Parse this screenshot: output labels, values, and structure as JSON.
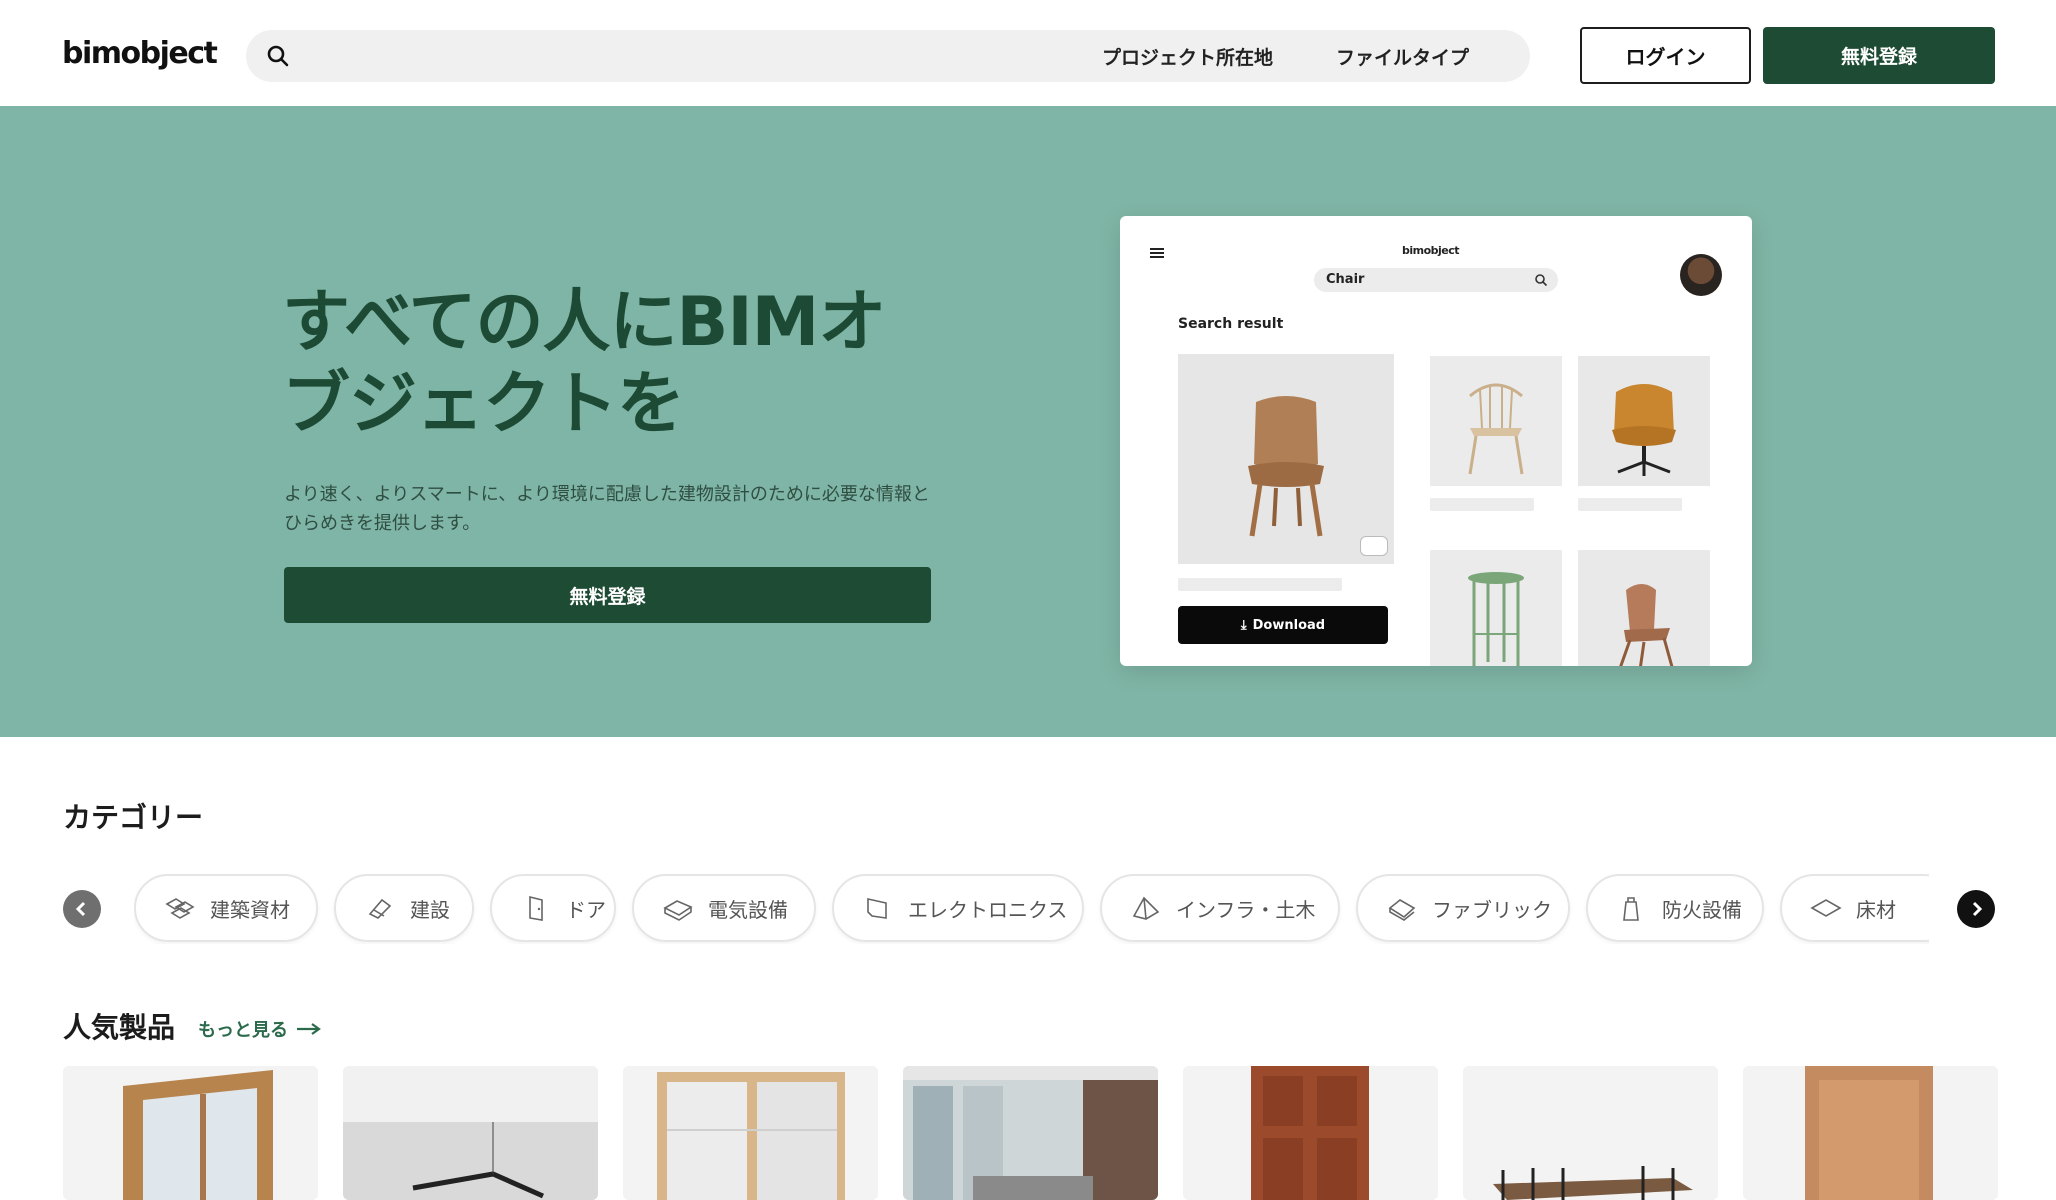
{
  "header": {
    "logo": "bimobject",
    "search_options": [
      "プロジェクト所在地",
      "ファイルタイプ"
    ],
    "login_label": "ログイン",
    "register_label": "無料登録"
  },
  "hero": {
    "title": "すべての人にBIMオブジェクトを",
    "description": "より速く、よりスマートに、より環境に配慮した建物設計のために必要な情報とひらめきを提供します。",
    "cta_label": "無料登録",
    "mockup": {
      "logo": "bimobject",
      "search_text": "Chair",
      "result_label": "Search result",
      "download_label": "Download"
    }
  },
  "categories": {
    "title": "カテゴリー",
    "items": [
      {
        "label": "建築資材",
        "icon": "building-materials-icon"
      },
      {
        "label": "建設",
        "icon": "construction-icon"
      },
      {
        "label": "ドア",
        "icon": "door-icon"
      },
      {
        "label": "電気設備",
        "icon": "electrical-icon"
      },
      {
        "label": "エレクトロニクス",
        "icon": "electronics-icon"
      },
      {
        "label": "インフラ・土木",
        "icon": "infrastructure-icon"
      },
      {
        "label": "ファブリック",
        "icon": "fabric-icon"
      },
      {
        "label": "防火設備",
        "icon": "fire-safety-icon"
      },
      {
        "label": "床材",
        "icon": "flooring-icon"
      }
    ]
  },
  "popular": {
    "title": "人気製品",
    "more_label": "もっと見る",
    "products": [
      "window-frame",
      "pendant-lamp",
      "sliding-door",
      "interior-room",
      "wooden-door",
      "dining-set",
      "cabinet-door"
    ]
  },
  "colors": {
    "brand_green": "#1e4b33",
    "hero_bg": "#7fb5a6",
    "link_green": "#2c6a4c"
  }
}
